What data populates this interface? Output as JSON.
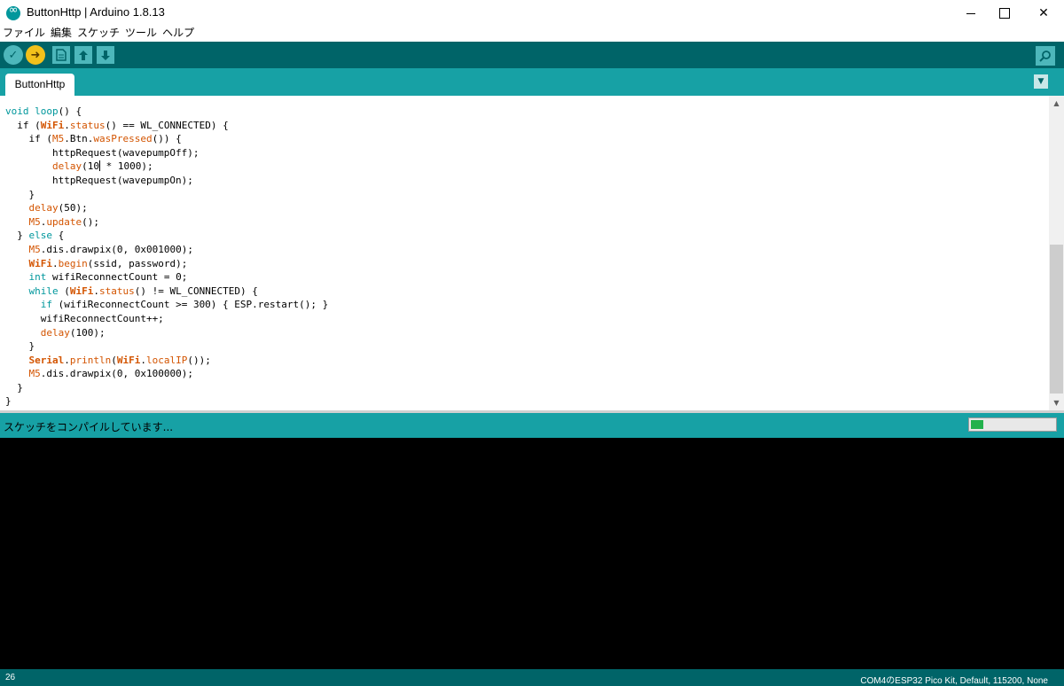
{
  "window": {
    "title": "ButtonHttp | Arduino 1.8.13",
    "app_icon": "arduino-icon"
  },
  "menu": {
    "items": [
      "ファイル",
      "編集",
      "スケッチ",
      "ツール",
      "ヘルプ"
    ]
  },
  "toolbar": {
    "verify_icon": "checkmark-icon",
    "upload_icon": "arrow-right-icon",
    "new_icon": "new-file-icon",
    "open_icon": "arrow-up-icon",
    "save_icon": "arrow-down-icon",
    "serial_monitor_icon": "magnifier-icon"
  },
  "tabs": {
    "active": "ButtonHttp",
    "menu_icon": "triangle-down-icon"
  },
  "editor": {
    "lines": [
      [
        {
          "t": "void",
          "c": "kw"
        },
        {
          "t": " "
        },
        {
          "t": "loop",
          "c": "kw"
        },
        {
          "t": "() {"
        }
      ],
      [
        {
          "t": "  if ("
        },
        {
          "t": "WiFi",
          "c": "cls"
        },
        {
          "t": "."
        },
        {
          "t": "status",
          "c": "fn"
        },
        {
          "t": "() == WL_CONNECTED) {"
        }
      ],
      [
        {
          "t": "    if ("
        },
        {
          "t": "M5",
          "c": "fn"
        },
        {
          "t": ".Btn."
        },
        {
          "t": "wasPressed",
          "c": "fn"
        },
        {
          "t": "()) {"
        }
      ],
      [
        {
          "t": "        httpRequest(wavepumpOff);"
        }
      ],
      [
        {
          "t": "        "
        },
        {
          "t": "delay",
          "c": "fn"
        },
        {
          "t": "(10"
        },
        {
          "t": "|CURSOR|"
        },
        {
          "t": " * 1000);"
        }
      ],
      [
        {
          "t": "        httpRequest(wavepumpOn);"
        }
      ],
      [
        {
          "t": "    }"
        }
      ],
      [
        {
          "t": "    "
        },
        {
          "t": "delay",
          "c": "fn"
        },
        {
          "t": "(50);"
        }
      ],
      [
        {
          "t": "    "
        },
        {
          "t": "M5",
          "c": "fn"
        },
        {
          "t": "."
        },
        {
          "t": "update",
          "c": "fn"
        },
        {
          "t": "();"
        }
      ],
      [
        {
          "t": "  } "
        },
        {
          "t": "else",
          "c": "kw"
        },
        {
          "t": " {"
        }
      ],
      [
        {
          "t": "    "
        },
        {
          "t": "M5",
          "c": "fn"
        },
        {
          "t": ".dis.drawpix(0, 0x001000);"
        }
      ],
      [
        {
          "t": "    "
        },
        {
          "t": "WiFi",
          "c": "cls"
        },
        {
          "t": "."
        },
        {
          "t": "begin",
          "c": "fn"
        },
        {
          "t": "(ssid, password);"
        }
      ],
      [
        {
          "t": "    "
        },
        {
          "t": "int",
          "c": "kw"
        },
        {
          "t": " wifiReconnectCount = 0;"
        }
      ],
      [
        {
          "t": "    "
        },
        {
          "t": "while",
          "c": "kw"
        },
        {
          "t": " ("
        },
        {
          "t": "WiFi",
          "c": "cls"
        },
        {
          "t": "."
        },
        {
          "t": "status",
          "c": "fn"
        },
        {
          "t": "() != WL_CONNECTED) {"
        }
      ],
      [
        {
          "t": "      "
        },
        {
          "t": "if",
          "c": "kw"
        },
        {
          "t": " (wifiReconnectCount >= 300) { ESP.restart(); }"
        }
      ],
      [
        {
          "t": "      wifiReconnectCount++;"
        }
      ],
      [
        {
          "t": "      "
        },
        {
          "t": "delay",
          "c": "fn"
        },
        {
          "t": "(100);"
        }
      ],
      [
        {
          "t": "    }"
        }
      ],
      [
        {
          "t": "    "
        },
        {
          "t": "Serial",
          "c": "cls"
        },
        {
          "t": "."
        },
        {
          "t": "println",
          "c": "fn"
        },
        {
          "t": "("
        },
        {
          "t": "WiFi",
          "c": "cls"
        },
        {
          "t": "."
        },
        {
          "t": "localIP",
          "c": "fn"
        },
        {
          "t": "());"
        }
      ],
      [
        {
          "t": "    "
        },
        {
          "t": "M5",
          "c": "fn"
        },
        {
          "t": ".dis.drawpix(0, 0x100000);"
        }
      ],
      [
        {
          "t": "  }"
        }
      ],
      [
        {
          "t": "}"
        }
      ]
    ]
  },
  "status": {
    "message": "スケッチをコンパイルしています...",
    "progress": 0.15
  },
  "footer": {
    "line_number": "26",
    "board_info": "COM4のESP32 Pico Kit, Default, 115200, None"
  }
}
